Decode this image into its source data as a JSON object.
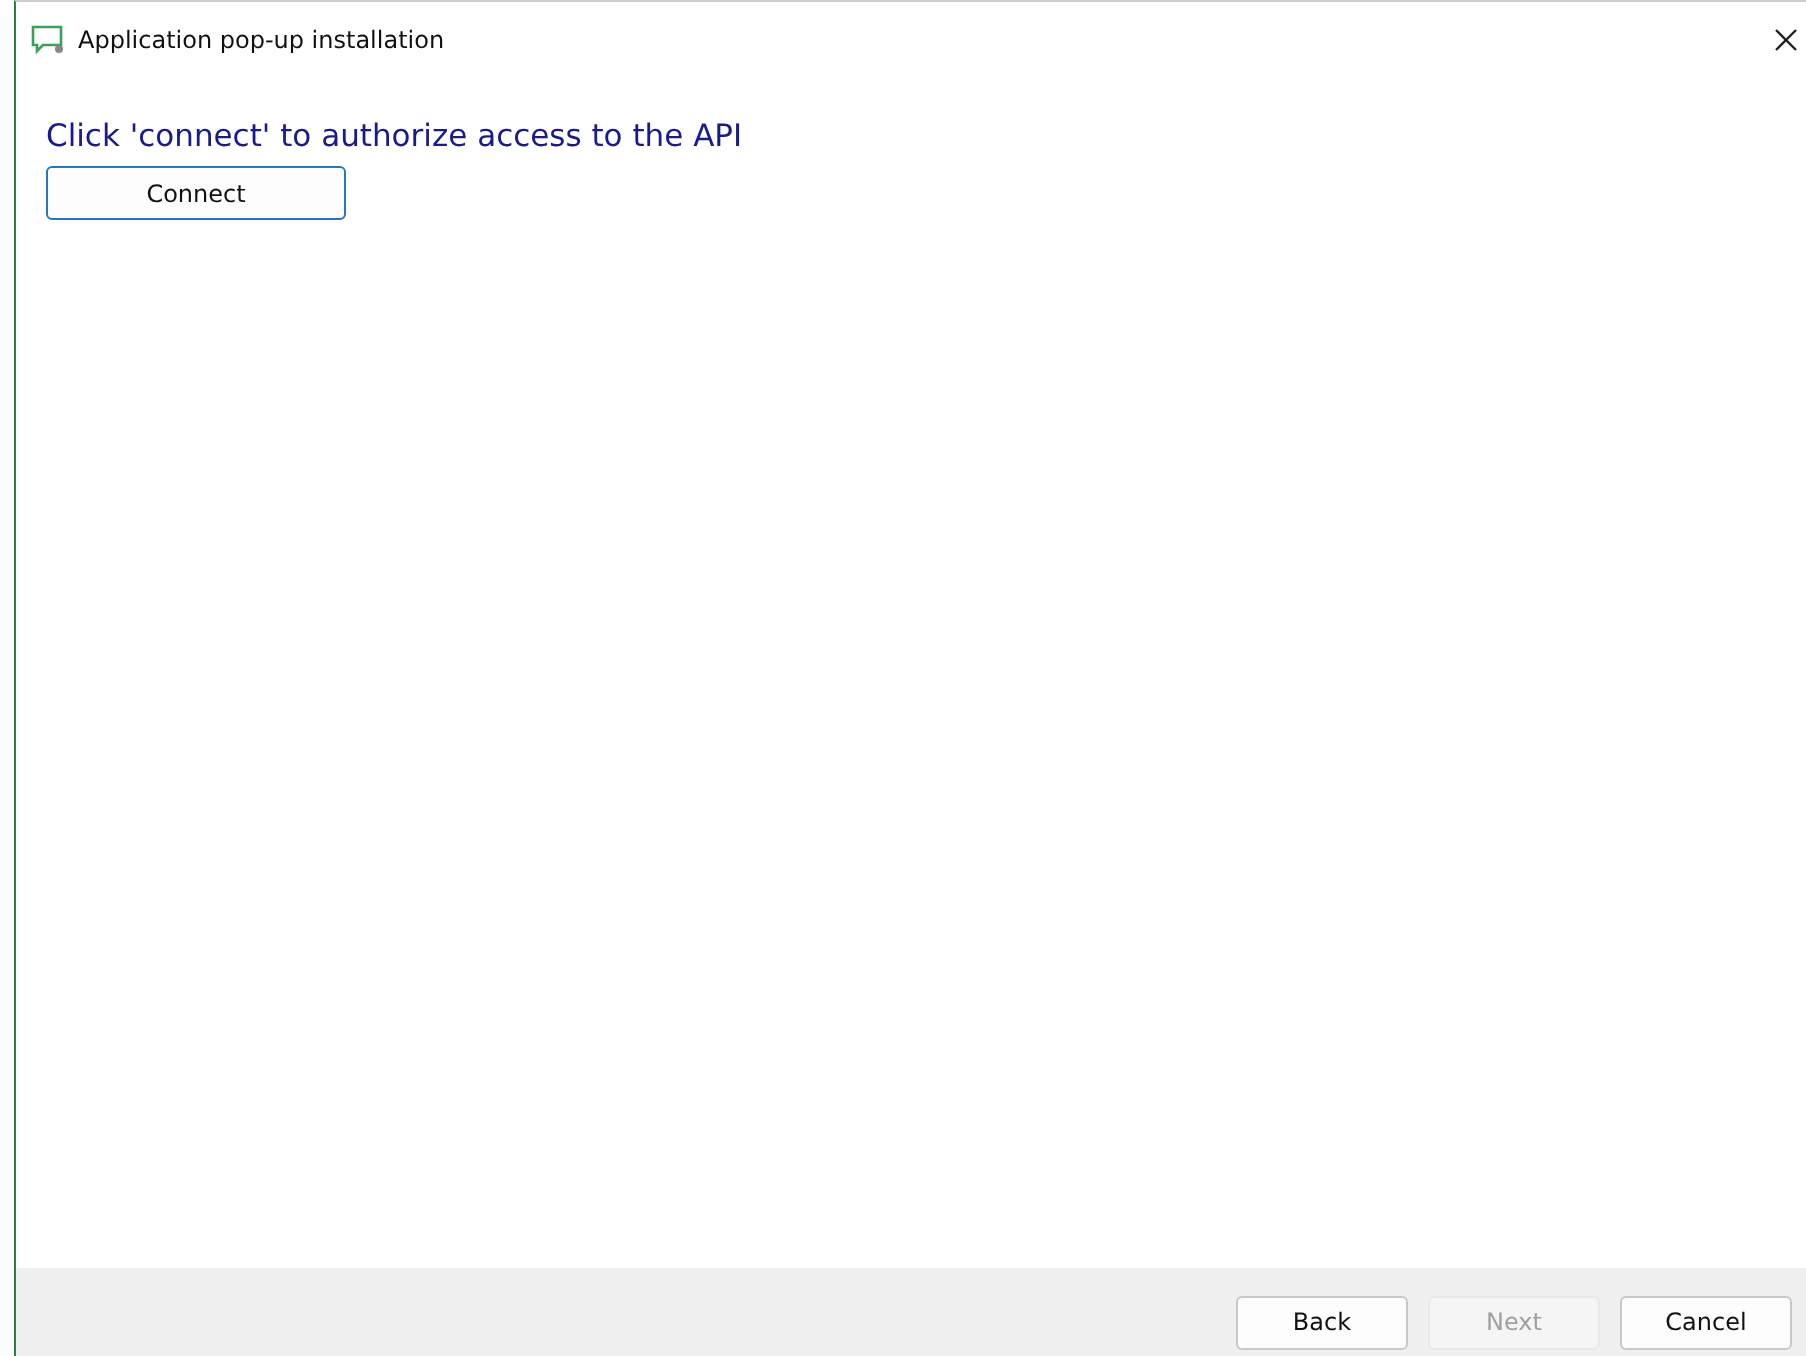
{
  "window": {
    "title": "Application pop-up installation"
  },
  "instruction": "Click 'connect' to authorize access to the API",
  "connect_button": {
    "label": "Connect",
    "disabled": false
  },
  "footer_buttons": [
    {
      "label": "Back",
      "disabled": false
    },
    {
      "label": "Next",
      "disabled": true
    },
    {
      "label": "Cancel",
      "disabled": false
    }
  ]
}
